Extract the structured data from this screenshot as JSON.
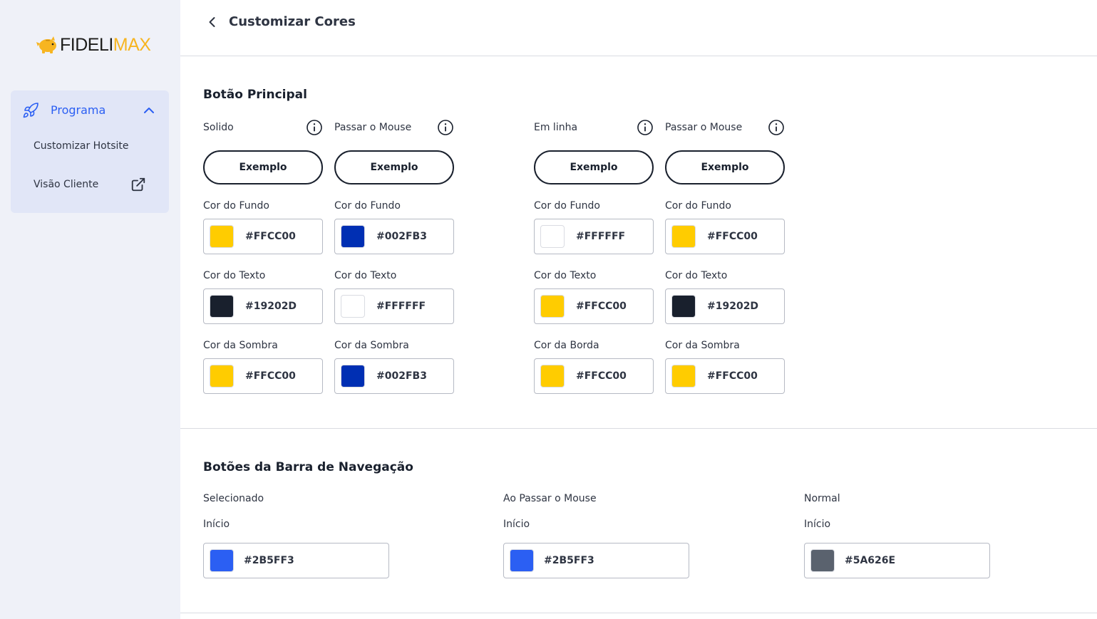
{
  "sidebar": {
    "logo": {
      "part1": "FIDELI",
      "part2": "MAX"
    },
    "program": {
      "label": "Programa",
      "items": [
        {
          "label": "Customizar Hotsite"
        },
        {
          "label": "Visão Cliente"
        }
      ]
    }
  },
  "header": {
    "title": "Customizar Cores"
  },
  "main_button": {
    "title": "Botão Principal",
    "columns": [
      {
        "label": "Solido",
        "example": "Exemplo",
        "fields": [
          {
            "label": "Cor do Fundo",
            "color": "#FFCC00",
            "hex": "#FFCC00"
          },
          {
            "label": "Cor do Texto",
            "color": "#19202D",
            "hex": "#19202D"
          },
          {
            "label": "Cor da Sombra",
            "color": "#FFCC00",
            "hex": "#FFCC00"
          }
        ]
      },
      {
        "label": "Passar o Mouse",
        "example": "Exemplo",
        "fields": [
          {
            "label": "Cor do Fundo",
            "color": "#002FB3",
            "hex": "#002FB3"
          },
          {
            "label": "Cor do Texto",
            "color": "#FFFFFF",
            "hex": "#FFFFFF"
          },
          {
            "label": "Cor da Sombra",
            "color": "#002FB3",
            "hex": "#002FB3"
          }
        ]
      },
      {
        "label": "Em linha",
        "example": "Exemplo",
        "fields": [
          {
            "label": "Cor do Fundo",
            "color": "#FFFFFF",
            "hex": "#FFFFFF"
          },
          {
            "label": "Cor do Texto",
            "color": "#FFCC00",
            "hex": "#FFCC00"
          },
          {
            "label": "Cor da Borda",
            "color": "#FFCC00",
            "hex": "#FFCC00"
          }
        ]
      },
      {
        "label": "Passar o Mouse",
        "example": "Exemplo",
        "fields": [
          {
            "label": "Cor do Fundo",
            "color": "#FFCC00",
            "hex": "#FFCC00"
          },
          {
            "label": "Cor do Texto",
            "color": "#19202D",
            "hex": "#19202D"
          },
          {
            "label": "Cor da Sombra",
            "color": "#FFCC00",
            "hex": "#FFCC00"
          }
        ]
      }
    ]
  },
  "nav_buttons": {
    "title": "Botões da Barra de Navegação",
    "columns": [
      {
        "label": "Selecionado",
        "field_label": "Início",
        "color": "#2B5FF3",
        "hex": "#2B5FF3"
      },
      {
        "label": "Ao Passar o Mouse",
        "field_label": "Início",
        "color": "#2B5FF3",
        "hex": "#2B5FF3"
      },
      {
        "label": "Normal",
        "field_label": "Início",
        "color": "#5A626E",
        "hex": "#5A626E"
      }
    ]
  }
}
